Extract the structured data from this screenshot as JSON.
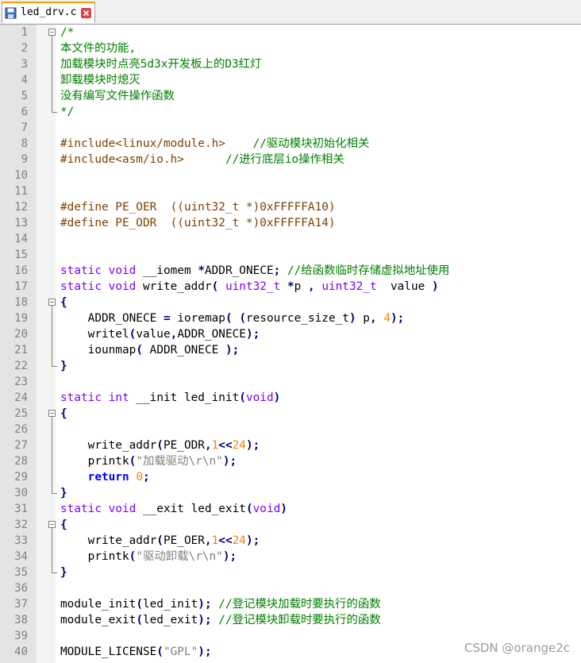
{
  "tab": {
    "label": "led_drv.c",
    "icon": "save-disk-icon",
    "close_icon": "close-icon"
  },
  "line_numbers": [
    "1",
    "2",
    "3",
    "4",
    "5",
    "6",
    "7",
    "8",
    "9",
    "10",
    "11",
    "12",
    "13",
    "14",
    "15",
    "16",
    "17",
    "18",
    "19",
    "20",
    "21",
    "22",
    "23",
    "24",
    "25",
    "26",
    "27",
    "28",
    "29",
    "30",
    "31",
    "32",
    "33",
    "34",
    "35",
    "36",
    "37",
    "38",
    "39",
    "40"
  ],
  "code": {
    "l1": "/*",
    "l2": "本文件的功能,",
    "l3": "加载模块时点亮5d3x开发板上的D3红灯",
    "l4": "卸载模块时熄灭",
    "l5": "没有编写文件操作函数",
    "l6": "*/",
    "l8_pp": "#include<linux/module.h>",
    "l8_cm": "//驱动模块初始化相关",
    "l9_pp": "#include<asm/io.h>",
    "l9_cm": "//进行底层io操作相关",
    "l12": "#define PE_OER  ((uint32_t *)0xFFFFFA10)",
    "l13": "#define PE_ODR  ((uint32_t *)0xFFFFFA14)",
    "kw_static": "static",
    "kw_void": "void",
    "kw_int": "int",
    "kw_return": "return",
    "l16_a": "__iomem",
    "l16_b": "ADDR_ONECE",
    "l16_cm": "//给函数临时存储虚拟地址使用",
    "l17_fn": "write_addr",
    "l17_type": "uint32_t",
    "l17_p": "p",
    "l17_v": "value",
    "l19_a": "ADDR_ONECE",
    "l19_b": "ioremap",
    "l19_c": "resource_size_t",
    "l19_d": "p",
    "l19_n": "4",
    "l20_a": "writel",
    "l20_b": "value",
    "l20_c": "ADDR_ONECE",
    "l21_a": "iounmap",
    "l21_b": "ADDR_ONECE",
    "l24_a": "__init led_init",
    "l27_a": "write_addr",
    "l27_b": "PE_ODR",
    "n1": "1",
    "n24": "24",
    "l28_a": "printk",
    "l28_s": "\"加载驱动\\r\\n\"",
    "n0": "0",
    "l31_a": "__exit led_exit",
    "l33_b": "PE_OER",
    "l34_s": "\"驱动卸载\\r\\n\"",
    "l37_a": "module_init",
    "l37_b": "led_init",
    "l37_cm": "//登记模块加载时要执行的函数",
    "l38_a": "module_exit",
    "l38_b": "led_exit",
    "l38_cm": "//登记模块卸载时要执行的函数",
    "l40_a": "MODULE_LICENSE",
    "l40_s": "\"GPL\""
  },
  "watermark": "CSDN @orange2c",
  "colors": {
    "comment": "#008000",
    "preprocessor": "#804000",
    "keyword": "#8000ff",
    "number": "#ff8000",
    "string": "#808080",
    "operator": "#000080"
  }
}
